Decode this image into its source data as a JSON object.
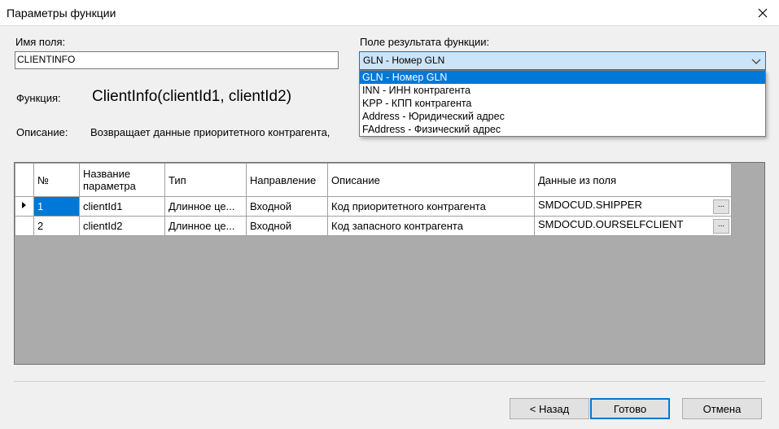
{
  "window": {
    "title": "Параметры функции"
  },
  "field_name": {
    "label": "Имя поля:",
    "value": "CLIENTINFO"
  },
  "result_field": {
    "label": "Поле результата функции:",
    "selected": "GLN - Номер GLN",
    "options": [
      "GLN - Номер GLN",
      "INN - ИНН контрагента",
      "KPP - КПП контрагента",
      "Address - Юридический адрес",
      "FAddress - Физический адрес"
    ]
  },
  "function": {
    "label": "Функция:",
    "value": "ClientInfo(clientId1, clientId2)"
  },
  "description": {
    "label": "Описание:",
    "value": "Возвращает данные приоритетного контрагента,"
  },
  "table": {
    "columns": [
      "№",
      "Название параметра",
      "Тип",
      "Направление",
      "Описание",
      "Данные из поля"
    ],
    "rows": [
      {
        "num": "1",
        "name": "clientId1",
        "type": "Длинное це...",
        "direction": "Входной",
        "desc": "Код приоритетного контрагента",
        "data": "SMDOCUD.SHIPPER",
        "btn": "..."
      },
      {
        "num": "2",
        "name": "clientId2",
        "type": "Длинное це...",
        "direction": "Входной",
        "desc": "Код запасного контрагента",
        "data": "SMDOCUD.OURSELFCLIENT",
        "btn": "..."
      }
    ]
  },
  "buttons": {
    "back": "< Назад",
    "done": "Готово",
    "cancel": "Отмена"
  },
  "colors": {
    "accent": "#0078d7",
    "grid_bg": "#ababab",
    "combo_bg": "#cce4f7"
  },
  "icons": {
    "close": "close-icon",
    "dropdown": "chevron-down-icon",
    "row_indicator": "row-indicator-icon"
  }
}
